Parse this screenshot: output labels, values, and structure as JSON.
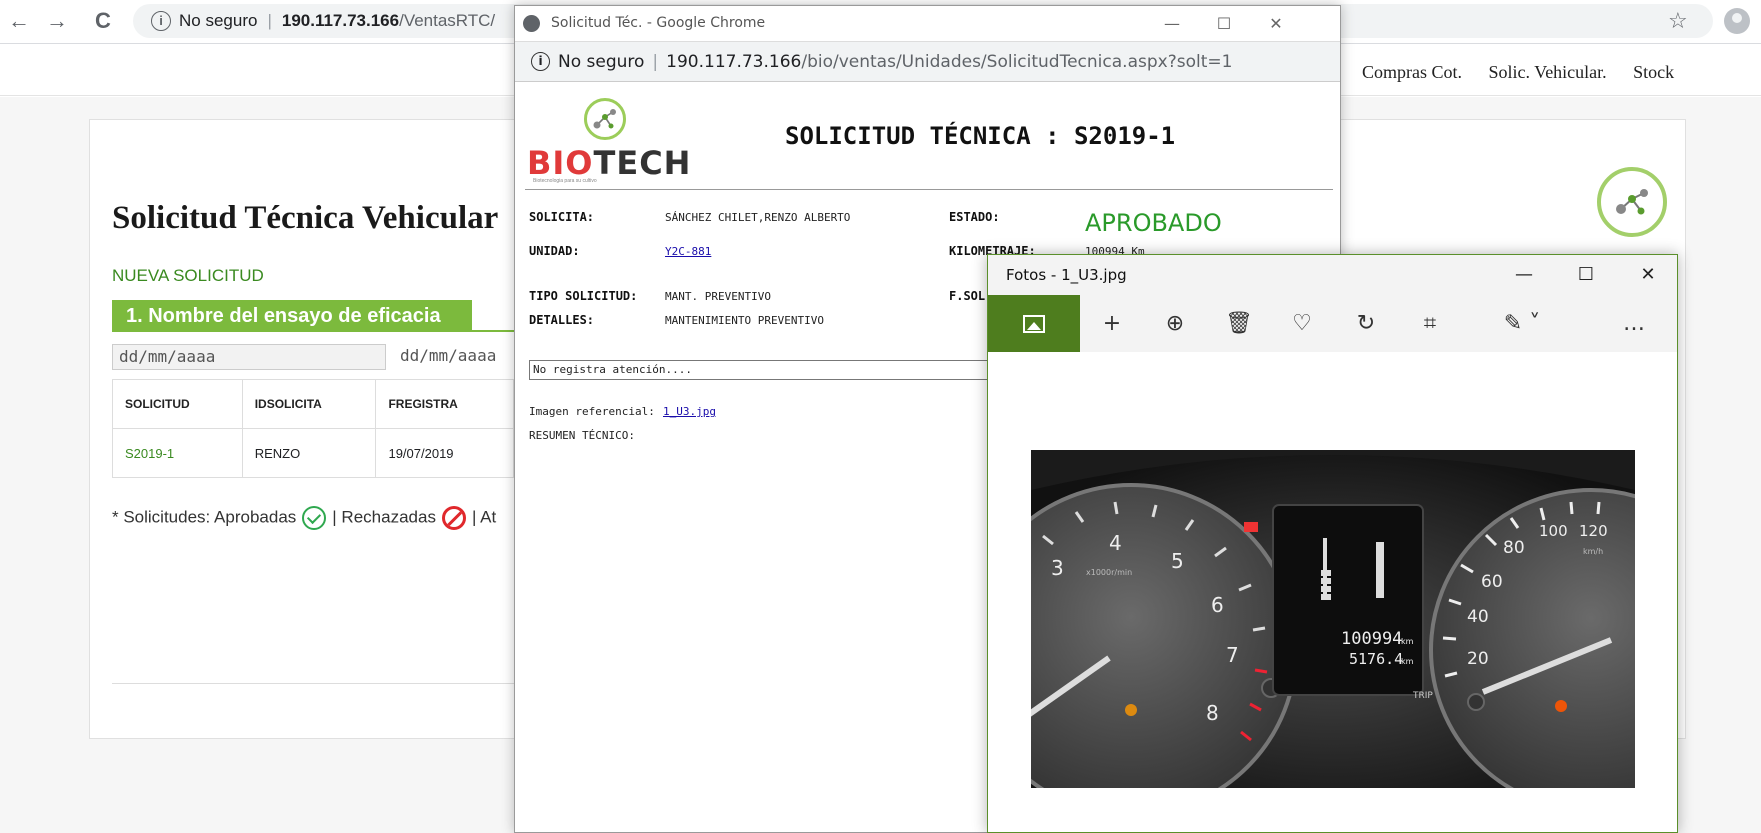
{
  "browser": {
    "back": "←",
    "forward": "→",
    "reload": "C",
    "security": "No seguro",
    "url_host": "190.117.73.166",
    "url_path": "/VentasRTC/",
    "star": "☆"
  },
  "site_nav": [
    "Compras Cot.",
    "Solic. Vehicular.",
    "Stock"
  ],
  "main": {
    "title": "Solicitud Técnica Vehicular",
    "new_request": "NUEVA SOLICITUD",
    "section_title": "1. Nombre del ensayo de eficacia",
    "date_from_placeholder": "dd/mm/aaaa",
    "date_to_placeholder": "dd/mm/aaaa",
    "table": {
      "headers": [
        "SOLICITUD",
        "IDSOLICITA",
        "FREGISTRA"
      ],
      "rows": [
        [
          "S2019-1",
          "RENZO",
          "19/07/2019"
        ]
      ]
    },
    "legend_prefix": "* Solicitudes: Aprobadas",
    "legend_rejected": "| Rechazadas",
    "legend_suffix": "| At"
  },
  "popup": {
    "title": "Solicitud Téc. - Google Chrome",
    "minimize": "—",
    "maximize": "☐",
    "close": "✕",
    "security": "No seguro",
    "url_host": "190.117.73.166",
    "url_path": "/bio/ventas/Unidades/SolicitudTecnica.aspx?solt=1",
    "logo_bio": "BIO",
    "logo_tech": "TECH",
    "logo_tagline": "Biotecnologia para su cultivo",
    "heading": "SOLICITUD TÉCNICA : S2019-1",
    "fields": {
      "solicita_label": "SOLICITA:",
      "solicita_value": "SÁNCHEZ CHILET,RENZO ALBERTO",
      "estado_label": "ESTADO:",
      "estado_value": "APROBADO",
      "unidad_label": "UNIDAD:",
      "unidad_value": "Y2C-881",
      "km_label": "KILOMETRAJE:",
      "km_value": "100994 Km",
      "tipo_label": "TIPO SOLICITUD:",
      "tipo_value": "MANT. PREVENTIVO",
      "fsol_label": "F.SOL",
      "detalles_label": "DETALLES:",
      "detalles_value": "MANTENIMIENTO PREVENTIVO",
      "atencion": "No registra atención....",
      "imagen_label": "Imagen referencial:",
      "imagen_value": "1_U3.jpg",
      "resumen_label": "RESUMEN TÉCNICO:"
    }
  },
  "fotos": {
    "title": "Fotos - 1_U3.jpg",
    "minimize": "—",
    "maximize": "☐",
    "close": "✕",
    "toolbar": {
      "add": "+",
      "zoom": "⊕",
      "delete": "🗑",
      "favorite": "♡",
      "rotate": "↻",
      "crop": "⌗",
      "edit": "✎ ˅",
      "more": "…"
    },
    "photo": {
      "odometer": "100994",
      "odometer_unit": "km",
      "trip": "5176.4",
      "trip_unit": "km",
      "trip_label": "TRIP",
      "rpm_unit": "x1000r/min",
      "speed_unit": "km/h",
      "rpm_ticks": [
        "3",
        "4",
        "5",
        "6",
        "7",
        "8"
      ],
      "speed_ticks": [
        "100",
        "120",
        "80",
        "60",
        "40",
        "20"
      ]
    }
  }
}
